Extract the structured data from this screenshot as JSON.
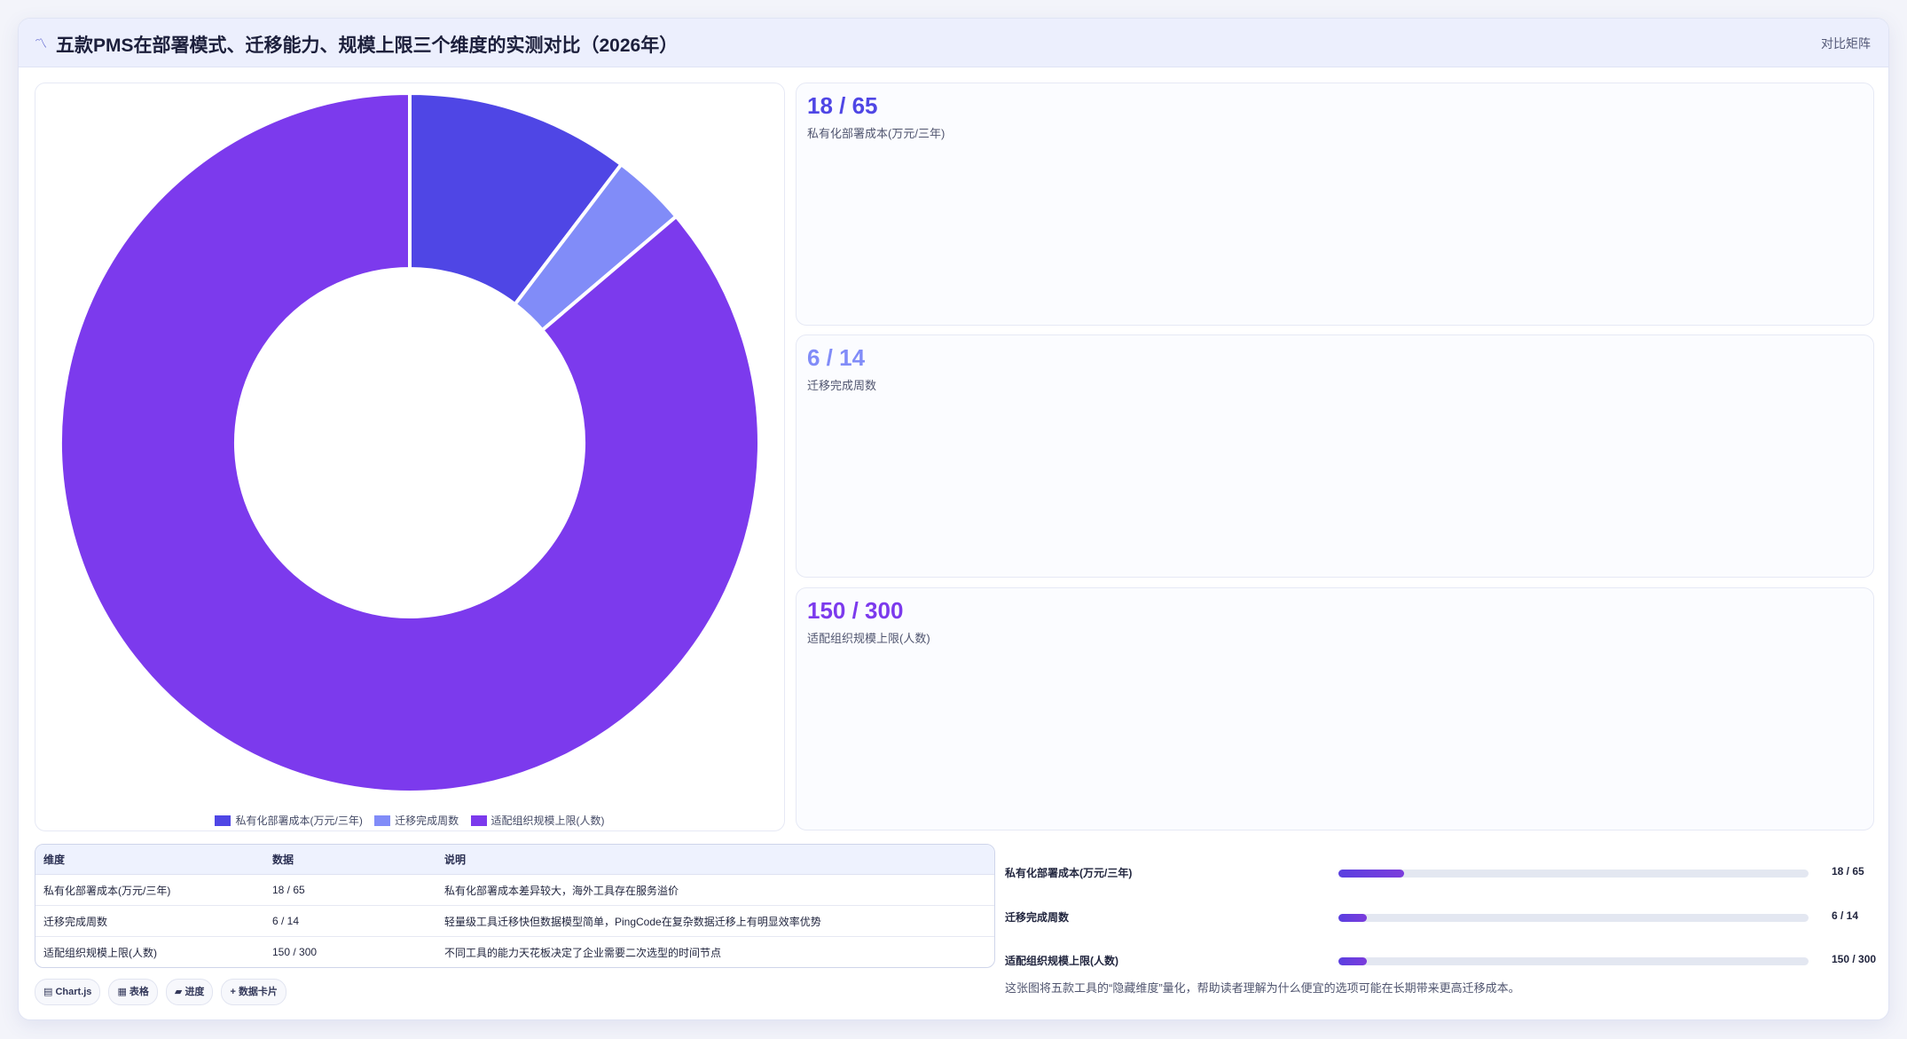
{
  "header": {
    "title": "五款PMS在部署模式、迁移能力、规模上限三个维度的实测对比（2026年）",
    "action_label": "对比矩阵"
  },
  "chart_data": {
    "type": "pie",
    "title": "",
    "labels": [
      "私有化部署成本(万元/三年)",
      "迁移完成周数",
      "适配组织规模上限(人数)"
    ],
    "values": [
      18,
      6,
      150
    ],
    "colors": [
      "#4f46e5",
      "#818cf8",
      "#7c3aed"
    ],
    "donut": true,
    "legend_position": "bottom"
  },
  "stats": [
    {
      "value": "18 / 65",
      "label": "私有化部署成本(万元/三年)",
      "color": "#4f46e5"
    },
    {
      "value": "6 / 14",
      "label": "迁移完成周数",
      "color": "#818cf8"
    },
    {
      "value": "150 / 300",
      "label": "适配组织规模上限(人数)",
      "color": "#7c3aed"
    }
  ],
  "table": {
    "headers": [
      "维度",
      "数据",
      "说明"
    ],
    "rows": [
      [
        "私有化部署成本(万元/三年)",
        "18 / 65",
        "私有化部署成本差异较大，海外工具存在服务溢价"
      ],
      [
        "迁移完成周数",
        "6 / 14",
        "轻量级工具迁移快但数据模型简单，PingCode在复杂数据迁移上有明显效率优势"
      ],
      [
        "适配组织规模上限(人数)",
        "150 / 300",
        "不同工具的能力天花板决定了企业需要二次选型的时间节点"
      ]
    ]
  },
  "chips": [
    {
      "icon": "▤",
      "label": "Chart.js"
    },
    {
      "icon": "▦",
      "label": "表格"
    },
    {
      "icon": "▰",
      "label": "进度"
    },
    {
      "icon": "+",
      "label": "数据卡片"
    }
  ],
  "progress": [
    {
      "label": "私有化部署成本(万元/三年)",
      "value_text": "18 / 65",
      "fraction": 0.14
    },
    {
      "label": "迁移完成周数",
      "value_text": "6 / 14",
      "fraction": 0.06
    },
    {
      "label": "适配组织规模上限(人数)",
      "value_text": "150 / 300",
      "fraction": 0.06
    }
  ],
  "note": "这张图将五款工具的“隐藏维度”量化，帮助读者理解为什么便宜的选项可能在长期带来更高迁移成本。"
}
